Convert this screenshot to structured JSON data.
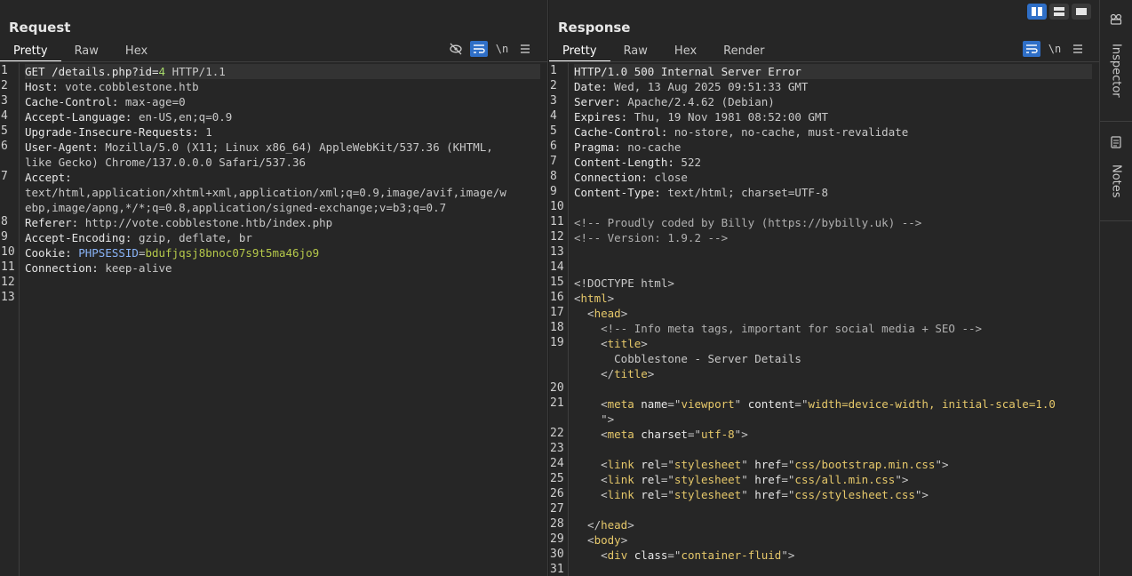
{
  "request": {
    "title": "Request",
    "tabs": [
      "Pretty",
      "Raw",
      "Hex"
    ],
    "active_tab": "Pretty",
    "tools": [
      "eye-off-icon",
      "wrap-icon",
      "\\n",
      "menu-icon"
    ],
    "lines": [
      {
        "n": "1",
        "k": "GET /details.php?id=",
        "num": "4",
        "v": " HTTP/1.1",
        "hl": true
      },
      {
        "n": "2",
        "k": "Host: ",
        "v": "vote.cobblestone.htb"
      },
      {
        "n": "3",
        "k": "Cache-Control: ",
        "v": "max-age=0"
      },
      {
        "n": "4",
        "k": "Accept-Language: ",
        "v": "en-US,en;q=0.9"
      },
      {
        "n": "5",
        "k": "Upgrade-Insecure-Requests: ",
        "v": "1"
      },
      {
        "n": "6",
        "k": "User-Agent: ",
        "v": "Mozilla/5.0 (X11; Linux x86_64) AppleWebKit/537.36 (KHTML,"
      },
      {
        "n": "",
        "k": "",
        "v": "like Gecko) Chrome/137.0.0.0 Safari/537.36"
      },
      {
        "n": "7",
        "k": "Accept:",
        "v": ""
      },
      {
        "n": "",
        "k": "",
        "v": "text/html,application/xhtml+xml,application/xml;q=0.9,image/avif,image/w"
      },
      {
        "n": "",
        "k": "",
        "v": "ebp,image/apng,*/*;q=0.8,application/signed-exchange;v=b3;q=0.7"
      },
      {
        "n": "8",
        "k": "Referer: ",
        "v": "http://vote.cobblestone.htb/index.php"
      },
      {
        "n": "9",
        "k": "Accept-Encoding: ",
        "v": "gzip, deflate, br"
      },
      {
        "n": "10",
        "k": "Cookie: ",
        "ck": "PHPSESSID",
        "v": "=",
        "cv": "bdufjqsj8bnoc07s9t5ma46jo9"
      },
      {
        "n": "11",
        "k": "Connection: ",
        "v": "keep-alive"
      },
      {
        "n": "12",
        "k": "",
        "v": ""
      },
      {
        "n": "13",
        "k": "",
        "v": ""
      }
    ]
  },
  "response": {
    "title": "Response",
    "tabs": [
      "Pretty",
      "Raw",
      "Hex",
      "Render"
    ],
    "active_tab": "Pretty",
    "tools": [
      "wrap-icon",
      "\\n",
      "menu-icon"
    ],
    "lines": [
      {
        "n": "1",
        "parts": [
          [
            "k",
            "HTTP/1.0 500 Internal Server Error"
          ]
        ],
        "hl": true
      },
      {
        "n": "2",
        "parts": [
          [
            "k",
            "Date: "
          ],
          [
            "v",
            "Wed, 13 Aug 2025 09:51:33 GMT"
          ]
        ]
      },
      {
        "n": "3",
        "parts": [
          [
            "k",
            "Server: "
          ],
          [
            "v",
            "Apache/2.4.62 (Debian)"
          ]
        ]
      },
      {
        "n": "4",
        "parts": [
          [
            "k",
            "Expires: "
          ],
          [
            "v",
            "Thu, 19 Nov 1981 08:52:00 GMT"
          ]
        ]
      },
      {
        "n": "5",
        "parts": [
          [
            "k",
            "Cache-Control: "
          ],
          [
            "v",
            "no-store, no-cache, must-revalidate"
          ]
        ]
      },
      {
        "n": "6",
        "parts": [
          [
            "k",
            "Pragma: "
          ],
          [
            "v",
            "no-cache"
          ]
        ]
      },
      {
        "n": "7",
        "parts": [
          [
            "k",
            "Content-Length: "
          ],
          [
            "v",
            "522"
          ]
        ]
      },
      {
        "n": "8",
        "parts": [
          [
            "k",
            "Connection: "
          ],
          [
            "v",
            "close"
          ]
        ]
      },
      {
        "n": "9",
        "parts": [
          [
            "k",
            "Content-Type: "
          ],
          [
            "v",
            "text/html; charset=UTF-8"
          ]
        ]
      },
      {
        "n": "10",
        "parts": []
      },
      {
        "n": "11",
        "parts": [
          [
            "cmt",
            "<!-- Proudly coded by Billy (https://bybilly.uk) -->"
          ]
        ]
      },
      {
        "n": "12",
        "parts": [
          [
            "cmt",
            "<!-- Version: 1.9.2 -->"
          ]
        ]
      },
      {
        "n": "13",
        "parts": []
      },
      {
        "n": "14",
        "parts": []
      },
      {
        "n": "15",
        "parts": [
          [
            "v",
            "<!DOCTYPE html>"
          ]
        ]
      },
      {
        "n": "16",
        "parts": [
          [
            "v",
            "<"
          ],
          [
            "tag",
            "html"
          ],
          [
            "v",
            ">"
          ]
        ]
      },
      {
        "n": "17",
        "parts": [
          [
            "v",
            "  <"
          ],
          [
            "tag",
            "head"
          ],
          [
            "v",
            ">"
          ]
        ]
      },
      {
        "n": "18",
        "parts": [
          [
            "cmt",
            "    <!-- Info meta tags, important for social media + SEO -->"
          ]
        ]
      },
      {
        "n": "19",
        "parts": [
          [
            "v",
            "    <"
          ],
          [
            "tag",
            "title"
          ],
          [
            "v",
            ">"
          ]
        ]
      },
      {
        "n": "",
        "parts": [
          [
            "v",
            "      Cobblestone - Server Details"
          ]
        ]
      },
      {
        "n": "",
        "parts": [
          [
            "v",
            "    </"
          ],
          [
            "tag",
            "title"
          ],
          [
            "v",
            ">"
          ]
        ]
      },
      {
        "n": "20",
        "parts": []
      },
      {
        "n": "21",
        "parts": [
          [
            "v",
            "    <"
          ],
          [
            "tag",
            "meta "
          ],
          [
            "attr",
            "name"
          ],
          [
            "v",
            "=\""
          ],
          [
            "str",
            "viewport"
          ],
          [
            "v",
            "\" "
          ],
          [
            "attr",
            "content"
          ],
          [
            "v",
            "=\""
          ],
          [
            "str",
            "width=device-width, initial-scale=1.0"
          ]
        ]
      },
      {
        "n": "",
        "parts": [
          [
            "v",
            "    \">"
          ]
        ]
      },
      {
        "n": "22",
        "parts": [
          [
            "v",
            "    <"
          ],
          [
            "tag",
            "meta "
          ],
          [
            "attr",
            "charset"
          ],
          [
            "v",
            "=\""
          ],
          [
            "str",
            "utf-8"
          ],
          [
            "v",
            "\">"
          ]
        ]
      },
      {
        "n": "23",
        "parts": []
      },
      {
        "n": "24",
        "parts": [
          [
            "v",
            "    <"
          ],
          [
            "tag",
            "link "
          ],
          [
            "attr",
            "rel"
          ],
          [
            "v",
            "=\""
          ],
          [
            "str",
            "stylesheet"
          ],
          [
            "v",
            "\" "
          ],
          [
            "attr",
            "href"
          ],
          [
            "v",
            "=\""
          ],
          [
            "str",
            "css/bootstrap.min.css"
          ],
          [
            "v",
            "\">"
          ]
        ]
      },
      {
        "n": "25",
        "parts": [
          [
            "v",
            "    <"
          ],
          [
            "tag",
            "link "
          ],
          [
            "attr",
            "rel"
          ],
          [
            "v",
            "=\""
          ],
          [
            "str",
            "stylesheet"
          ],
          [
            "v",
            "\" "
          ],
          [
            "attr",
            "href"
          ],
          [
            "v",
            "=\""
          ],
          [
            "str",
            "css/all.min.css"
          ],
          [
            "v",
            "\">"
          ]
        ]
      },
      {
        "n": "26",
        "parts": [
          [
            "v",
            "    <"
          ],
          [
            "tag",
            "link "
          ],
          [
            "attr",
            "rel"
          ],
          [
            "v",
            "=\""
          ],
          [
            "str",
            "stylesheet"
          ],
          [
            "v",
            "\" "
          ],
          [
            "attr",
            "href"
          ],
          [
            "v",
            "=\""
          ],
          [
            "str",
            "css/stylesheet.css"
          ],
          [
            "v",
            "\">"
          ]
        ]
      },
      {
        "n": "27",
        "parts": []
      },
      {
        "n": "28",
        "parts": [
          [
            "v",
            "  </"
          ],
          [
            "tag",
            "head"
          ],
          [
            "v",
            ">"
          ]
        ]
      },
      {
        "n": "29",
        "parts": [
          [
            "v",
            "  <"
          ],
          [
            "tag",
            "body"
          ],
          [
            "v",
            ">"
          ]
        ]
      },
      {
        "n": "30",
        "parts": [
          [
            "v",
            "    <"
          ],
          [
            "tag",
            "div "
          ],
          [
            "attr",
            "class"
          ],
          [
            "v",
            "=\""
          ],
          [
            "str",
            "container-fluid"
          ],
          [
            "v",
            "\">"
          ]
        ]
      },
      {
        "n": "31",
        "parts": []
      }
    ]
  },
  "layout_buttons": [
    "split-horizontal-icon",
    "split-vertical-icon",
    "single-pane-icon"
  ],
  "sidebar": {
    "items": [
      {
        "label": "Inspector",
        "icon": "inspector-icon"
      },
      {
        "label": "Notes",
        "icon": "notes-icon"
      }
    ]
  },
  "colors": {
    "accent": "#2f6fc7",
    "background": "#262626"
  }
}
